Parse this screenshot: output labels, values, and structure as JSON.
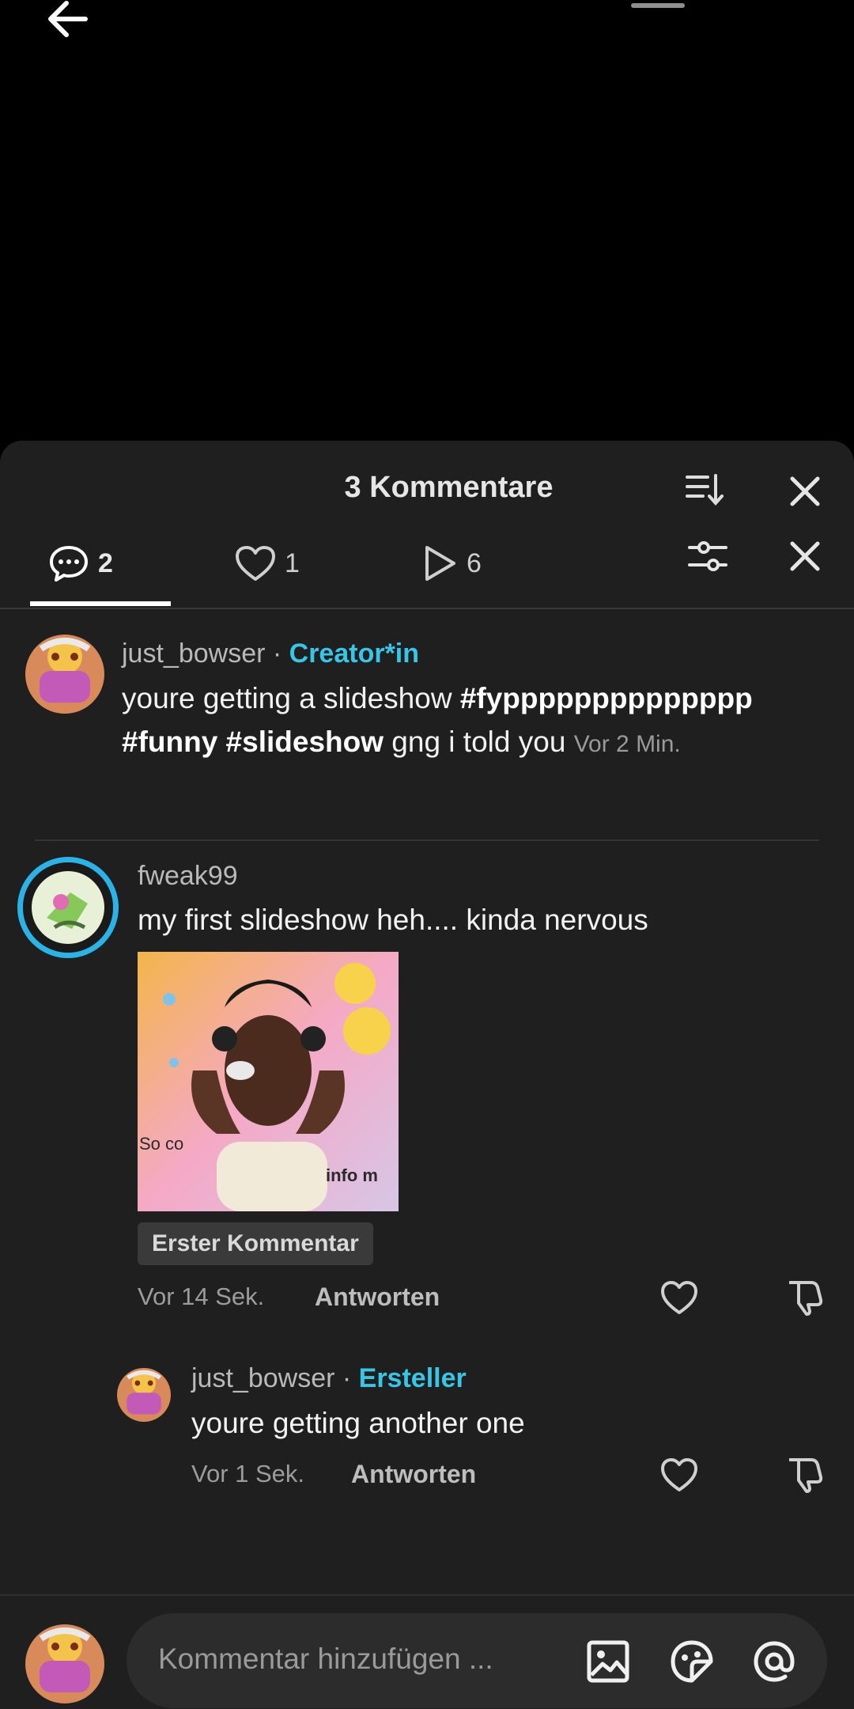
{
  "header": {
    "title": "3 Kommentare"
  },
  "tabs": [
    {
      "label": "2",
      "icon": "comment-bubble-icon"
    },
    {
      "label": "1",
      "icon": "heart-outline-icon"
    },
    {
      "label": "6",
      "icon": "play-outline-icon"
    }
  ],
  "comments": [
    {
      "username": "just_bowser",
      "separator": " · ",
      "badge": "Creator*in",
      "text_start": "youre getting a slideshow ",
      "text_tags": "#fypppppppppppppp #funny #slideshow",
      "text_end": " gng i told you ",
      "time": "Vor 2 Min."
    },
    {
      "username": "fweak99",
      "text": "my first slideshow heh.... kinda nervous",
      "sticker_caption_1": "So co",
      "sticker_caption_2": "info m",
      "first_badge": "Erster Kommentar",
      "time": "Vor 14 Sek.",
      "reply_label": "Antworten"
    }
  ],
  "reply": {
    "username": "just_bowser",
    "separator": " · ",
    "badge": "Ersteller",
    "text": "youre getting another one",
    "time": "Vor 1 Sek.",
    "reply_label": "Antworten"
  },
  "composer": {
    "placeholder": "Kommentar hinzufügen ..."
  },
  "colors": {
    "accent": "#38c6e6",
    "sheet_bg": "#1f1f1f",
    "input_bg": "#2c2c2c"
  }
}
